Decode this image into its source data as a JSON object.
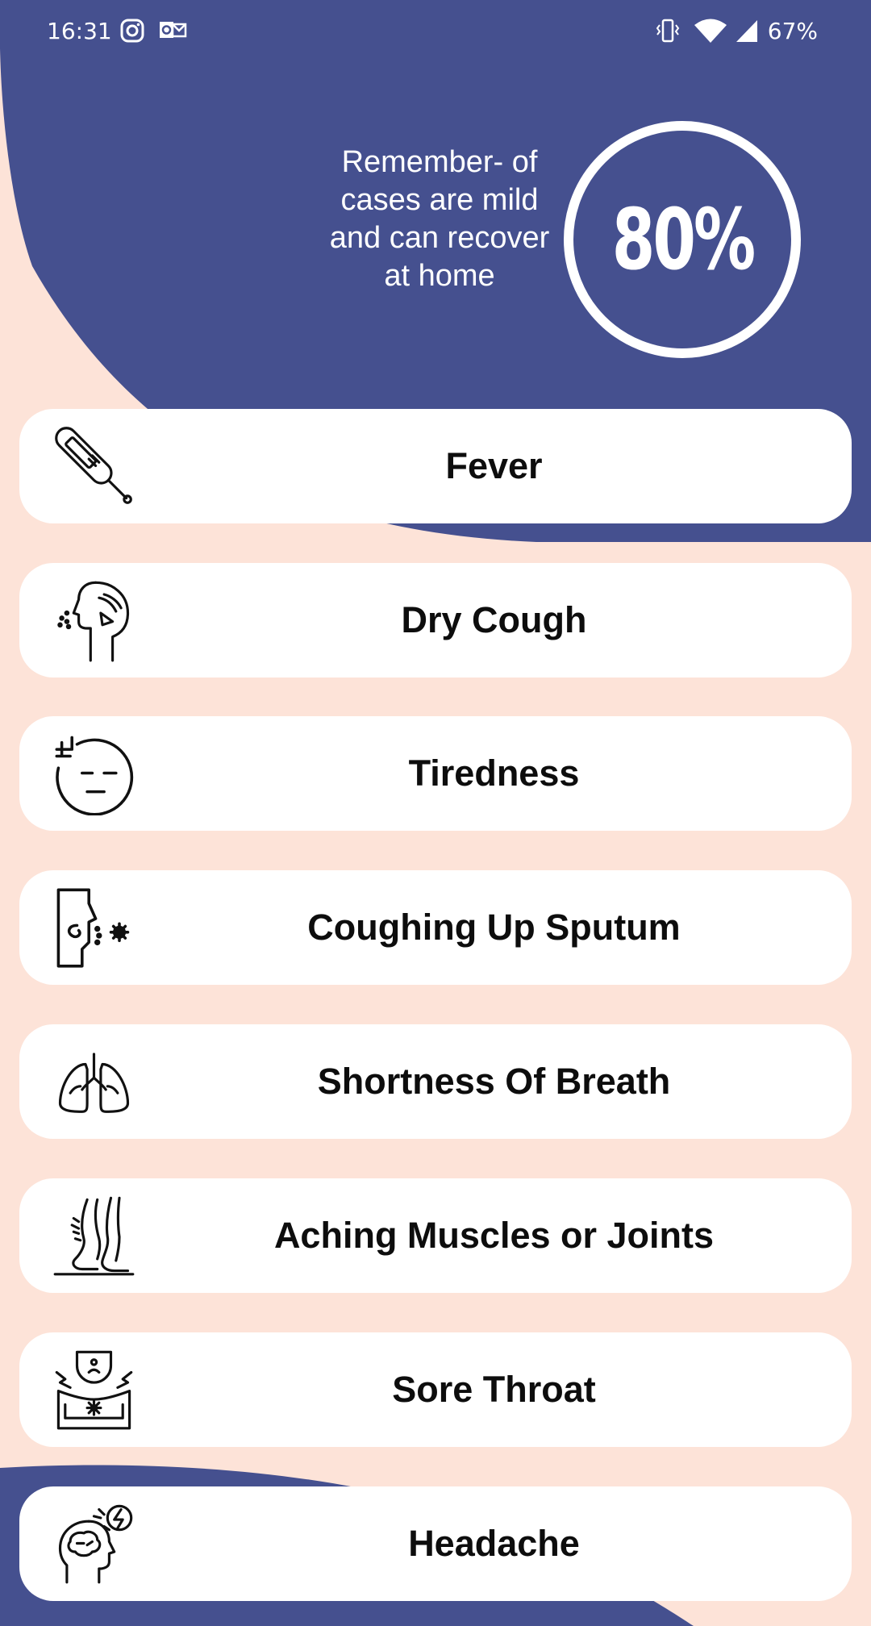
{
  "status_bar": {
    "time": "16:31",
    "battery": "67%",
    "icons": [
      "instagram-icon",
      "outlook-icon",
      "vibrate-icon",
      "wifi-icon",
      "signal-icon"
    ]
  },
  "hero": {
    "message": "Remember- of cases are mild and can recover at home",
    "stat": "80%"
  },
  "colors": {
    "navy": "#45508F",
    "peach": "#FDE3D8",
    "card": "#FFFFFF",
    "text": "#0D0D0D"
  },
  "symptoms": [
    {
      "label": "Fever",
      "icon": "thermometer-icon"
    },
    {
      "label": "Dry Cough",
      "icon": "cough-icon"
    },
    {
      "label": "Tiredness",
      "icon": "tired-face-icon"
    },
    {
      "label": "Coughing Up Sputum",
      "icon": "sputum-icon"
    },
    {
      "label": "Shortness Of Breath",
      "icon": "lungs-icon"
    },
    {
      "label": "Aching Muscles or Joints",
      "icon": "legs-icon"
    },
    {
      "label": "Sore Throat",
      "icon": "sore-throat-icon"
    },
    {
      "label": "Headache",
      "icon": "headache-icon"
    }
  ]
}
